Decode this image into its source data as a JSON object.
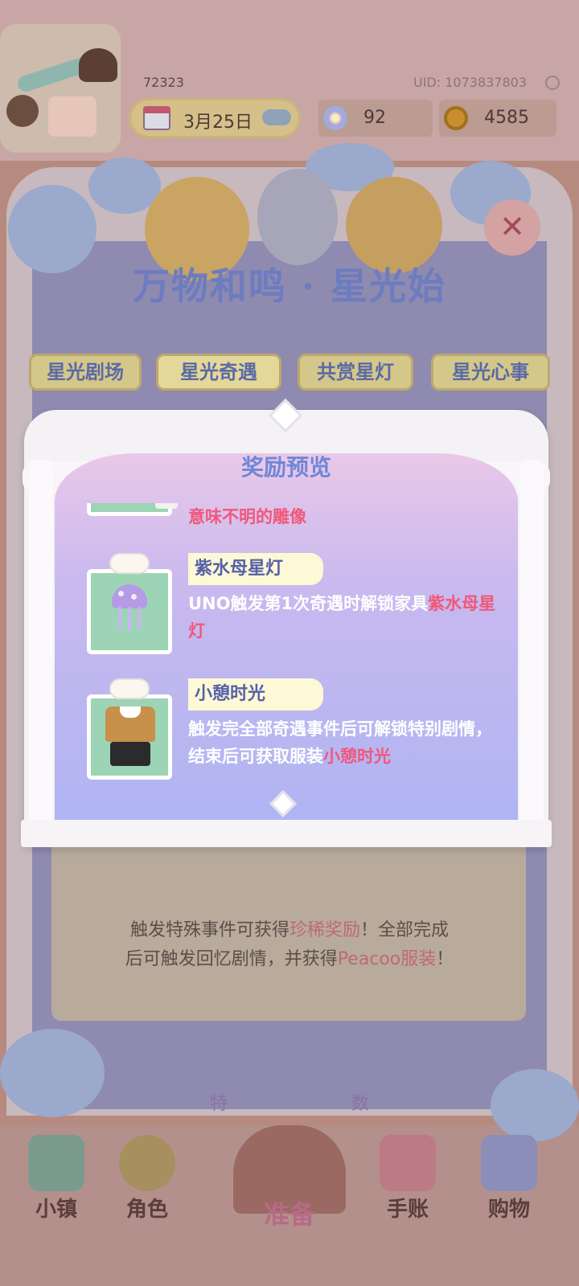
{
  "hud": {
    "player_id": "72323",
    "uid": "UID: 1073837803",
    "date": "3月25日",
    "star_count": "92",
    "coin_count": "4585"
  },
  "banner": {
    "title": "万物和鸣 · 星光始"
  },
  "tabs": [
    {
      "label": "星光剧场"
    },
    {
      "label": "星光奇遇"
    },
    {
      "label": "共赏星灯"
    },
    {
      "label": "星光心事"
    }
  ],
  "background_panel": {
    "line1_a": "触发特殊事件可获得",
    "line1_hl": "珍稀奖励",
    "line1_b": "！全部完成",
    "line2_a": "后可触发回忆剧情，并获得",
    "line2_hl": "Peacoo服装",
    "line2_b": "！",
    "special_count_a": "特",
    "special_count_b": "数"
  },
  "modal": {
    "title": "奖励预览",
    "rewards": [
      {
        "name": "",
        "desc": "意味不明的雕像"
      },
      {
        "name": "紫水母星灯",
        "desc_a": "UNO触发第1次奇遇时解锁家具",
        "desc_hl": "紫水母星灯"
      },
      {
        "name": "小憩时光",
        "desc_a": "触发完全部奇遇事件后可解锁特别剧情，结束后可获取服装",
        "desc_hl": "小憩时光"
      }
    ]
  },
  "bottom_nav": {
    "town": "小镇",
    "character": "角色",
    "prepare": "准备",
    "journal": "手账",
    "shop": "购物"
  },
  "colors": {
    "accent_pink": "#f0587a",
    "title_blue": "#6f87d6",
    "tab_text": "#5a6aa6"
  }
}
